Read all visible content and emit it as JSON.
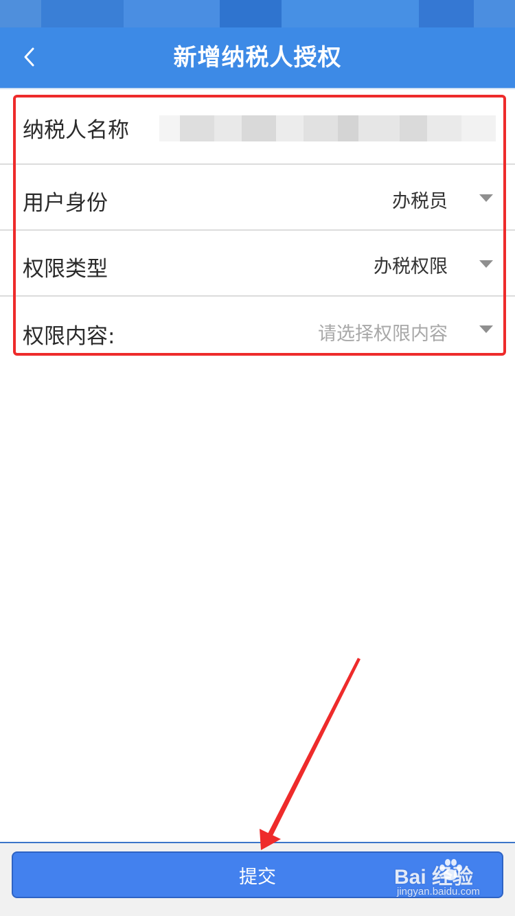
{
  "header": {
    "title": "新增纳税人授权",
    "back_icon": "chevron-left-icon"
  },
  "form": {
    "taxpayer_name": {
      "label": "纳税人名称",
      "value_note": "obscured"
    },
    "user_identity": {
      "label": "用户身份",
      "value": "办税员"
    },
    "permission_type": {
      "label": "权限类型",
      "value": "办税权限"
    },
    "permission_content": {
      "label": "权限内容:",
      "placeholder": "请选择权限内容"
    }
  },
  "footer": {
    "submit_label": "提交"
  },
  "watermark": {
    "main": "Bai  经验",
    "sub": "jingyan.baidu.com"
  },
  "colors": {
    "header": "#3d8ae6",
    "submit": "#4381ee",
    "highlight": "#ee2b2b",
    "divider": "#dcdcdc"
  }
}
